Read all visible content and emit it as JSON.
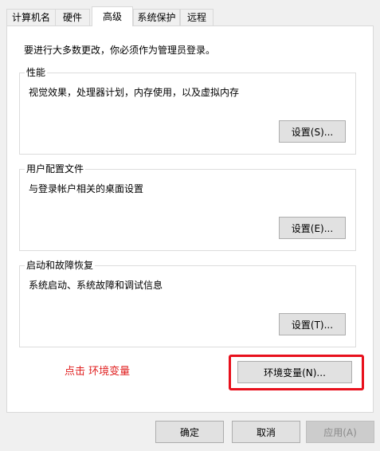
{
  "tabs": [
    {
      "label": "计算机名",
      "active": false
    },
    {
      "label": "硬件",
      "active": false
    },
    {
      "label": "高级",
      "active": true
    },
    {
      "label": "系统保护",
      "active": false
    },
    {
      "label": "远程",
      "active": false
    }
  ],
  "admin_note": "要进行大多数更改，你必须作为管理员登录。",
  "performance": {
    "title": "性能",
    "description": "视觉效果，处理器计划，内存使用，以及虚拟内存",
    "button": "设置(S)..."
  },
  "user_profiles": {
    "title": "用户配置文件",
    "description": "与登录帐户相关的桌面设置",
    "button": "设置(E)..."
  },
  "startup_recovery": {
    "title": "启动和故障恢复",
    "description": "系统启动、系统故障和调试信息",
    "button": "设置(T)..."
  },
  "annotation": {
    "hint": "点击 环境变量",
    "highlight_color": "#e8101c"
  },
  "env_button": "环境变量(N)...",
  "footer": {
    "ok": "确定",
    "cancel": "取消",
    "apply": "应用(A)",
    "apply_enabled": false
  }
}
